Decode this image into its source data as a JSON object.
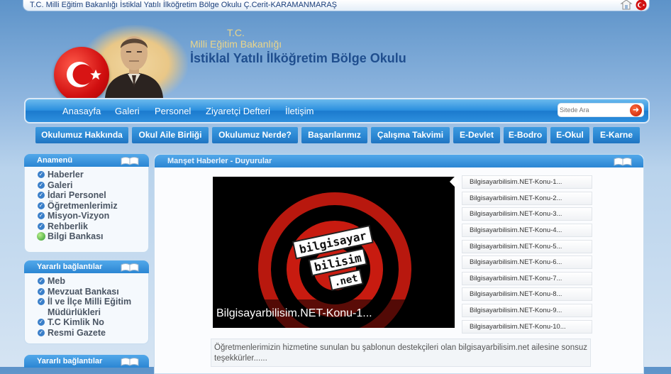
{
  "topbar": {
    "title": "T.C. Milli Eğitim Bakanlığı İstiklal Yatılı İlköğretim Bölge Okulu Ç.Cerit-KARAMANMARAŞ"
  },
  "header": {
    "tc": "T.C.",
    "ministry": "Milli Eğitim Bakanlığı",
    "school": "İstiklal Yatılı İlköğretim Bölge Okulu"
  },
  "nav": {
    "items": [
      "Anasayfa",
      "Galeri",
      "Personel",
      "Ziyaretçi Defteri",
      "İletişim"
    ],
    "search_placeholder": "Sitede Ara"
  },
  "tabs": [
    "Okulumuz Hakkında",
    "Okul Aile Birliği",
    "Okulumuz Nerde?",
    "Başarılarımız",
    "Çalışma Takvimi",
    "E-Devlet",
    "E-Bodro",
    "E-Okul",
    "E-Karne"
  ],
  "sidebar": {
    "menu": {
      "title": "Anamenü",
      "items": [
        "Haberler",
        "Galeri",
        "İdari Personel",
        "Öğretmenlerimiz",
        "Misyon-Vizyon",
        "Rehberlik",
        "Bilgi Bankası"
      ]
    },
    "links": {
      "title": "Yararlı bağlantılar",
      "items": [
        "Meb",
        "Mevzuat Bankası",
        "İl ve İlçe Milli Eğitim Müdürlükleri",
        "T.C Kimlik No",
        "Resmi Gazete"
      ]
    },
    "links2": {
      "title": "Yararlı bağlantılar"
    }
  },
  "panel": {
    "title": "Manşet Haberler - Duyurular",
    "slide_caption": "Bilgisayarbilisim.NET-Konu-1...",
    "slide_logo": [
      "bilgisayar",
      "bilisim",
      ".net"
    ],
    "topics": [
      "Bilgisayarbilisim.NET-Konu-1...",
      "Bilgisayarbilisim.NET-Konu-2...",
      "Bilgisayarbilisim.NET-Konu-3...",
      "Bilgisayarbilisim.NET-Konu-4...",
      "Bilgisayarbilisim.NET-Konu-5...",
      "Bilgisayarbilisim.NET-Konu-6...",
      "Bilgisayarbilisim.NET-Konu-7...",
      "Bilgisayarbilisim.NET-Konu-8...",
      "Bilgisayarbilisim.NET-Konu-9...",
      "Bilgisayarbilisim.NET-Konu-10..."
    ],
    "thanks": "Öğretmenlerimizin hizmetine sunulan bu şablonun destekçileri olan bilgisayarbilisim.net ailesine sonsuz teşekkürler......"
  },
  "colors": {
    "nav_blue": "#2b8fde",
    "heading_blue": "#1f4e8e",
    "gold": "#ead58a",
    "flag_red": "#d10f10"
  }
}
